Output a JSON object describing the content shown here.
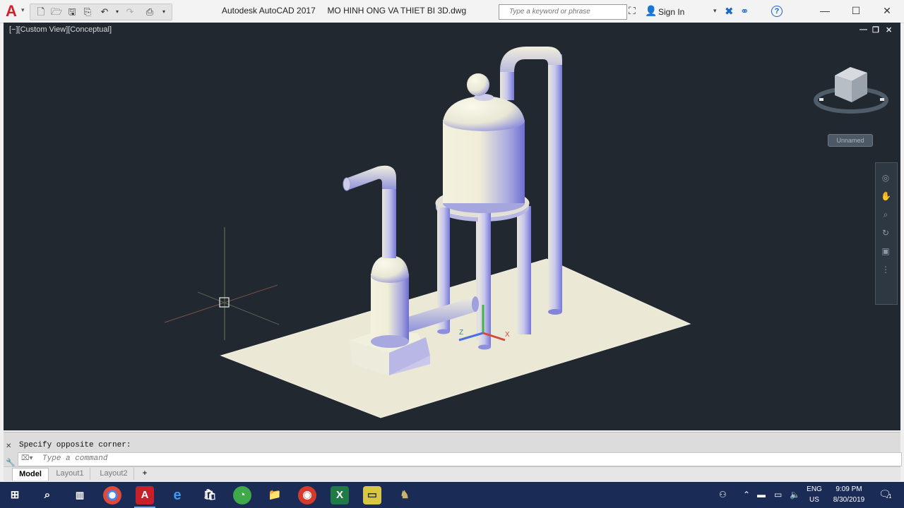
{
  "window": {
    "app_name": "Autodesk AutoCAD 2017",
    "file_name": "MO HINH ONG VA THIET BI 3D.dwg",
    "minimize": "—",
    "maximize": "☐",
    "close": "✕"
  },
  "app_menu": {
    "logo": "A",
    "caret": "▾"
  },
  "quick_access": {
    "icons": [
      "new-icon",
      "open-icon",
      "save-icon",
      "saveas-icon",
      "plot-icon",
      "undo-icon",
      "redo-icon",
      "workspace-icon"
    ]
  },
  "search": {
    "placeholder": "Type a keyword or phrase"
  },
  "account": {
    "sign_in": "Sign In"
  },
  "viewport": {
    "label": "[−][Custom View][Conceptual]",
    "controls": [
      "—",
      "❐",
      "✕"
    ],
    "viewcube_button": "Unnamed",
    "background": "#212830"
  },
  "command_line": {
    "history": "Specify opposite corner:",
    "placeholder": "Type a command"
  },
  "layout_tabs": [
    "Model",
    "Layout1",
    "Layout2"
  ],
  "layout_add": "+",
  "taskbar": {
    "apps": [
      "windows-start",
      "search",
      "task-view",
      "chrome",
      "autocad",
      "edge",
      "store",
      "app-green",
      "file-explorer",
      "app-red",
      "excel",
      "app-notes",
      "app-dark"
    ],
    "language": [
      "ENG",
      "US"
    ],
    "time": "9:09 PM",
    "date": "8/30/2019",
    "notification_count": "1"
  },
  "colors": {
    "model_surface": "#ebe8d6",
    "ucs_x": "#d44a3a",
    "ucs_y": "#44b34a",
    "ucs_z": "#4a70e0",
    "accent": "#1d64c9",
    "taskbar": "#1a2b56"
  }
}
